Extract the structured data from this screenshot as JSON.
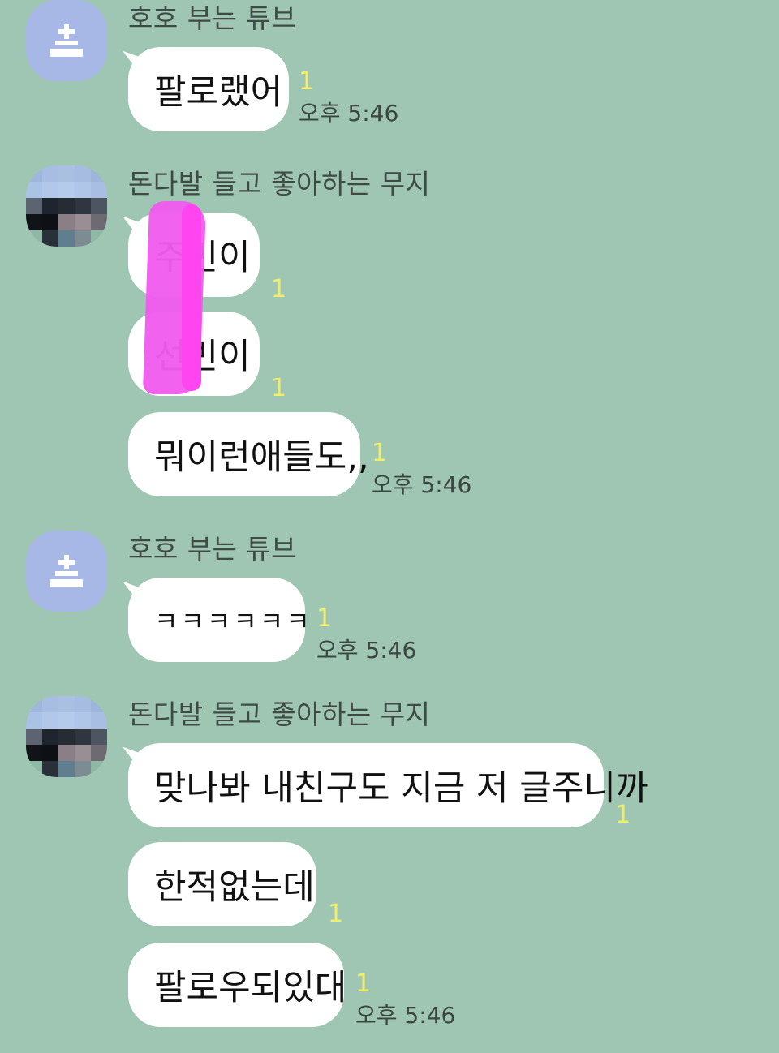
{
  "colors": {
    "background": "#9ec6b3",
    "bubble": "#ffffff",
    "unread": "#f2ee6a",
    "default_avatar": "#a8b8e6",
    "censor_mark": "#f05cee"
  },
  "icons": {
    "default_profile": "default-profile-person-icon",
    "pixelated_profile": "pixelated-profile-photo"
  },
  "groups": [
    {
      "sender": "호호 부는 튜브",
      "messages": [
        {
          "text": "팔로랬어",
          "unread": "1",
          "time": "오후 5:46"
        }
      ]
    },
    {
      "sender": "돈다발 들고 좋아하는 무지",
      "messages": [
        {
          "text": "주빈이",
          "unread": "1",
          "time": ""
        },
        {
          "text": "선빈이",
          "unread": "1",
          "time": ""
        },
        {
          "text": "뭐이런애들도,,",
          "unread": "1",
          "time": "오후 5:46"
        }
      ]
    },
    {
      "sender": "호호 부는 튜브",
      "messages": [
        {
          "text": "ㅋㅋㅋㅋㅋㅋ",
          "unread": "1",
          "time": "오후 5:46"
        }
      ]
    },
    {
      "sender": "돈다발 들고 좋아하는 무지",
      "messages": [
        {
          "text": "맞나봐 내친구도 지금 저 글주니까",
          "unread": "1",
          "time": ""
        },
        {
          "text": "한적없는데",
          "unread": "1",
          "time": ""
        },
        {
          "text": "팔로우되있대",
          "unread": "1",
          "time": "오후 5:46"
        }
      ]
    }
  ]
}
